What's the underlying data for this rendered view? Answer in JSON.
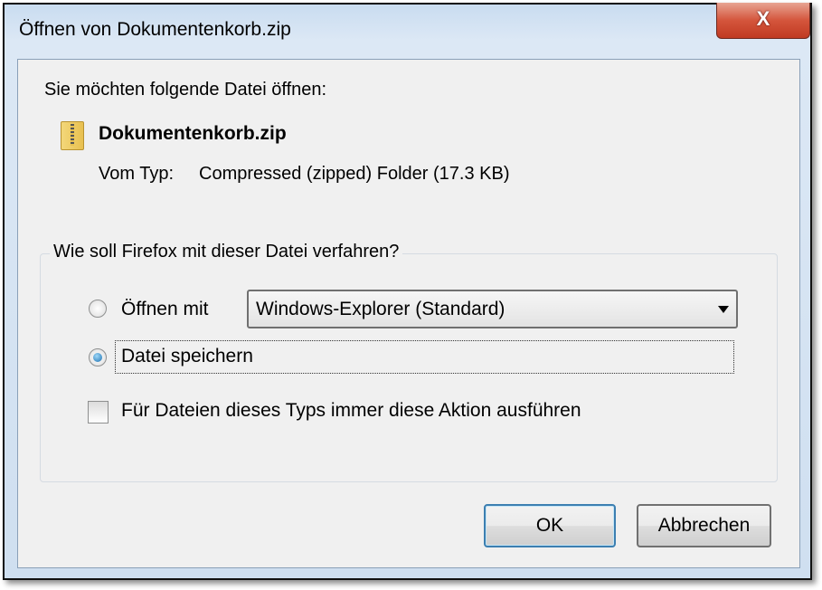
{
  "window": {
    "title": "Öffnen von Dokumentenkorb.zip",
    "close_label": "X"
  },
  "prompt": "Sie möchten folgende Datei öffnen:",
  "file": {
    "icon": "zip-folder-icon",
    "name": "Dokumentenkorb.zip",
    "type_label": "Vom Typ:",
    "type_value": "Compressed (zipped) Folder (17.3 KB)"
  },
  "action_group": {
    "legend": "Wie soll Firefox mit dieser Datei verfahren?",
    "open_with": {
      "label": "Öffnen mit",
      "selected": false,
      "app": "Windows-Explorer (Standard)"
    },
    "save": {
      "label": "Datei speichern",
      "selected": true
    },
    "always": {
      "label": "Für Dateien dieses Typs immer diese Aktion ausführen",
      "checked": false
    }
  },
  "buttons": {
    "ok": "OK",
    "cancel": "Abbrechen"
  }
}
